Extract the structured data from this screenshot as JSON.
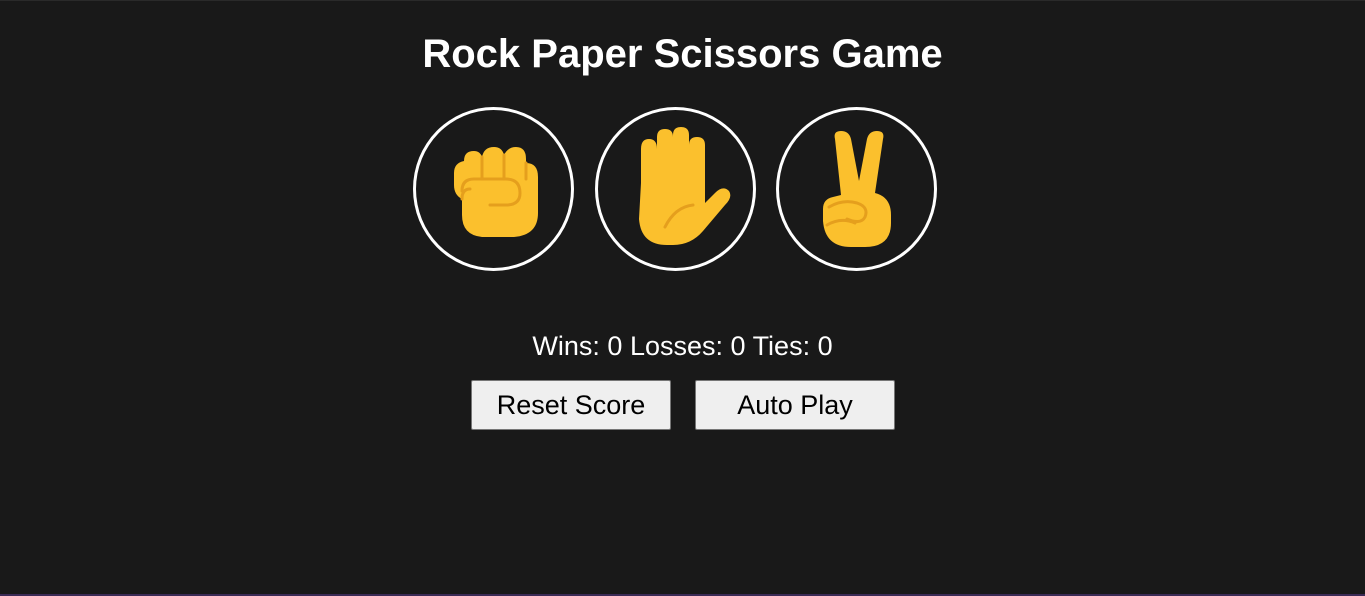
{
  "app": {
    "title": "Rock Paper Scissors Game"
  },
  "moves": [
    {
      "name": "rock",
      "icon": "raised-fist-icon",
      "skin": "#fbc02d",
      "line": "#e59f1d"
    },
    {
      "name": "paper",
      "icon": "raised-hand-icon",
      "skin": "#fbc02d",
      "line": "#e59f1d"
    },
    {
      "name": "scissors",
      "icon": "victory-hand-icon",
      "skin": "#fbc02d",
      "line": "#e59f1d"
    }
  ],
  "score": {
    "wins_label": "Wins:",
    "wins": 0,
    "losses_label": "Losses:",
    "losses": 0,
    "ties_label": "Ties:",
    "ties": 0
  },
  "controls": {
    "reset_label": "Reset Score",
    "auto_label": "Auto Play"
  },
  "colors": {
    "background": "#191919",
    "text": "#ffffff",
    "button_bg": "#efefef"
  }
}
